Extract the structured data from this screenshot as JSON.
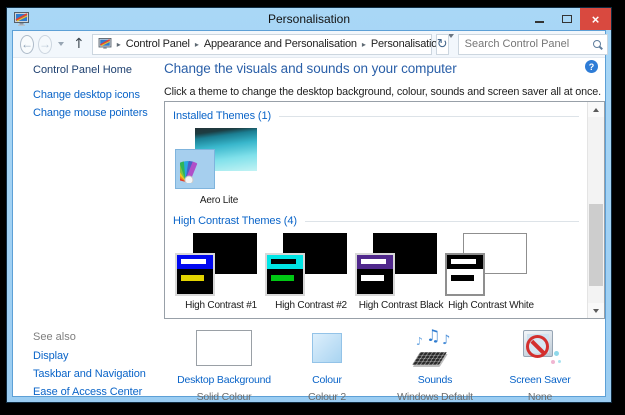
{
  "window": {
    "title": "Personalisation"
  },
  "navbar": {
    "breadcrumb": [
      "Control Panel",
      "Appearance and Personalisation",
      "Personalisation"
    ],
    "search_placeholder": "Search Control Panel"
  },
  "sidebar": {
    "home": "Control Panel Home",
    "links": [
      "Change desktop icons",
      "Change mouse pointers"
    ],
    "see_also": "See also",
    "see_also_links": [
      "Display",
      "Taskbar and Navigation",
      "Ease of Access Center"
    ]
  },
  "main": {
    "heading": "Change the visuals and sounds on your computer",
    "description": "Click a theme to change the desktop background, colour, sounds and screen saver all at once.",
    "installed_section": {
      "title": "Installed Themes (1)",
      "themes": [
        {
          "name": "Aero Lite"
        }
      ]
    },
    "high_contrast_section": {
      "title": "High Contrast Themes (4)",
      "themes": [
        {
          "name": "High Contrast #1",
          "back": "#000000",
          "card": "#000000",
          "bar": "#0008f0",
          "bar_stripe": "#ffffff",
          "accent": "#e3d400"
        },
        {
          "name": "High Contrast #2",
          "back": "#000000",
          "card": "#000000",
          "bar": "#00e6e6",
          "bar_stripe": "#000000",
          "accent": "#00c814"
        },
        {
          "name": "High Contrast Black",
          "back": "#000000",
          "card": "#000000",
          "bar": "#50288c",
          "bar_stripe": "#ffffff",
          "accent": "#ffffff"
        },
        {
          "name": "High Contrast White",
          "back": "#ffffff",
          "card": "#ffffff",
          "bar": "#000000",
          "bar_stripe": "#ffffff",
          "accent": "#000000"
        }
      ]
    },
    "footer_items": [
      {
        "label": "Desktop Background",
        "value": "Solid Colour"
      },
      {
        "label": "Colour",
        "value": "Colour 2"
      },
      {
        "label": "Sounds",
        "value": "Windows Default"
      },
      {
        "label": "Screen Saver",
        "value": "None"
      }
    ]
  },
  "colors": {
    "window_chrome": "#a9d7f6",
    "chrome_edge": "#5da0d6",
    "close_button": "#d9493f",
    "navbar_bg": "#f2f7fc",
    "link": "#0a64c8",
    "home_link": "#1d3f6f",
    "heading": "#2a5fa8",
    "section_header": "#0a64c8",
    "box_border": "#98a0a8",
    "help_blue": "#2e7cd6",
    "aero_front": "#a6cfee",
    "colour_swatch_from": "#ddeffc",
    "colour_swatch_to": "#a9d4f1",
    "note_blue": "#2f7cd0",
    "prohibit_red": "#d32f2e"
  }
}
